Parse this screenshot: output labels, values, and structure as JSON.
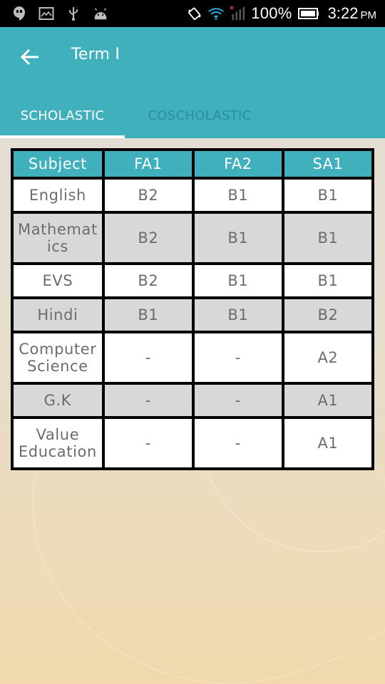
{
  "status_bar": {
    "left_icons": [
      "hangouts-icon",
      "gallery-icon",
      "usb-icon",
      "android-debug-icon"
    ],
    "right_icons": [
      "rotation-lock-icon",
      "wifi-icon",
      "signal-no-service-icon",
      "battery-icon"
    ],
    "battery_percent": "100%",
    "time": "3:22",
    "ampm": "PM"
  },
  "app_bar": {
    "back_icon": "arrow-left-icon",
    "title": "Term I"
  },
  "tabs": [
    {
      "label": "SCHOLASTIC",
      "selected": true
    },
    {
      "label": "COSCHOLASTIC",
      "selected": false
    }
  ],
  "colors": {
    "primary": "#3fb0bc",
    "tab_inactive": "#2a8f9b",
    "row_alt": "#d8d8d8",
    "cell_text": "#6c6c6c"
  },
  "table": {
    "headers": [
      "Subject",
      "FA1",
      "FA2",
      "SA1"
    ],
    "rows": [
      {
        "subject": "English",
        "fa1": "B2",
        "fa2": "B1",
        "sa1": "B1"
      },
      {
        "subject": "Mathemat ics",
        "fa1": "B2",
        "fa2": "B1",
        "sa1": "B1"
      },
      {
        "subject": "EVS",
        "fa1": "B2",
        "fa2": "B1",
        "sa1": "B1"
      },
      {
        "subject": "Hindi",
        "fa1": "B1",
        "fa2": "B1",
        "sa1": "B2"
      },
      {
        "subject": "Computer Science",
        "fa1": "-",
        "fa2": "-",
        "sa1": "A2"
      },
      {
        "subject": "G.K",
        "fa1": "-",
        "fa2": "-",
        "sa1": "A1"
      },
      {
        "subject": "Value Education",
        "fa1": "-",
        "fa2": "-",
        "sa1": "A1"
      }
    ]
  }
}
